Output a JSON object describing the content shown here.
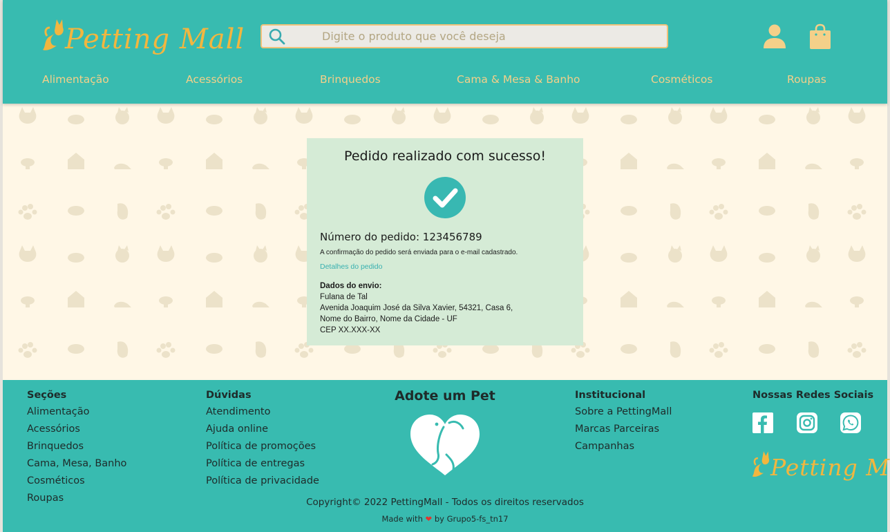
{
  "header": {
    "logo_text": "Petting Mall",
    "search_placeholder": "Digite o produto que você deseja",
    "icons": [
      "search-icon",
      "user-icon",
      "shopping-bag-icon"
    ],
    "nav": [
      "Alimentação",
      "Acessórios",
      "Brinquedos",
      "Cama & Mesa & Banho",
      "Cosméticos",
      "Roupas"
    ]
  },
  "confirmation": {
    "title": "Pedido realizado com sucesso!",
    "order_number": "Número do pedido: 123456789",
    "confirmation_note": "A confirmação do pedido será enviada para o e-mail cadastrado.",
    "details_link": "Detalhes do pedido",
    "shipping_heading": "Dados do envio:",
    "shipping_lines": [
      "Fulana de Tal",
      "Avenida Joaquim José da Silva Xavier, 54321, Casa 6,",
      "Nome do Bairro, Nome da Cidade - UF",
      "CEP XX.XXX-XX"
    ]
  },
  "footer": {
    "secoes": {
      "title": "Seções",
      "items": [
        "Alimentação",
        "Acessórios",
        "Brinquedos",
        "Cama, Mesa, Banho",
        "Cosméticos",
        "Roupas"
      ]
    },
    "duvidas": {
      "title": "Dúvidas",
      "items": [
        "Atendimento",
        "Ajuda online",
        "Política de promoções",
        "Política de entregas",
        "Política de privacidade"
      ]
    },
    "adote": {
      "title": "Adote um Pet"
    },
    "institucional": {
      "title": "Institucional",
      "items": [
        "Sobre a PettingMall",
        "Marcas Parceiras",
        "Campanhas"
      ]
    },
    "redes": {
      "title": "Nossas Redes Sociais",
      "icons": [
        "facebook-icon",
        "instagram-icon",
        "whatsapp-icon"
      ]
    },
    "copyright": "Copyright© 2022 PettingMall - Todos os direitos reservados",
    "made_with_prefix": "Made with",
    "made_with_suffix": "by Grupo5-fs_tn17"
  },
  "colors": {
    "teal": "#38bbb0",
    "gold": "#f2b63f",
    "cream": "#fff7e6",
    "card": "#d5ebd6"
  }
}
